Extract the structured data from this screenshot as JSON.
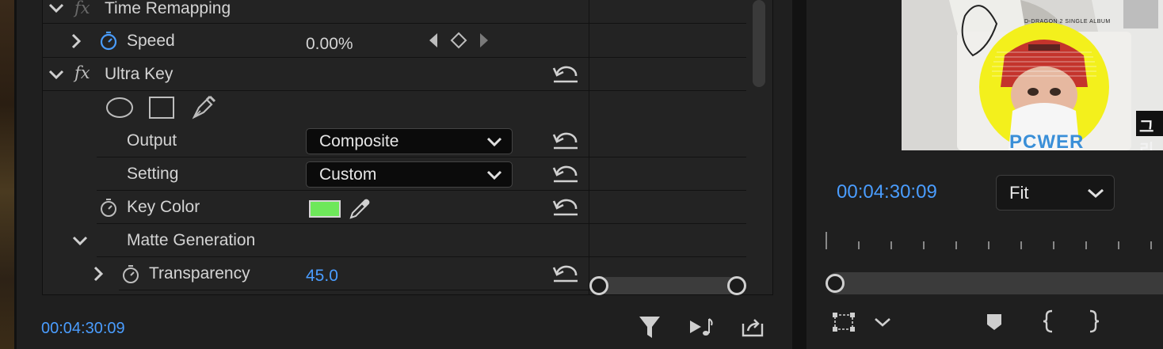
{
  "effect_controls": {
    "time_remapping": {
      "label": "Time Remapping"
    },
    "speed": {
      "label": "Speed",
      "value": "0.00%"
    },
    "ultra_key": {
      "label": "Ultra Key"
    },
    "output": {
      "label": "Output",
      "value": "Composite"
    },
    "setting": {
      "label": "Setting",
      "value": "Custom"
    },
    "key_color": {
      "label": "Key Color",
      "color": "#6ee85a"
    },
    "matte_generation": {
      "label": "Matte Generation"
    },
    "transparency": {
      "label": "Transparency",
      "value": "45.0"
    },
    "timecode": "00:04:30:09"
  },
  "program_monitor": {
    "timecode": "00:04:30:09",
    "zoom": {
      "value": "Fit"
    },
    "video": {
      "badge_text": "D-DRAGON 2 SINGLE ALBUM",
      "shirt_text": "PCWER",
      "subtitle_fragment": "그리"
    }
  },
  "colors": {
    "accent": "#4a9dff",
    "key_green": "#6ee85a",
    "video_circle": "#f3f01c"
  }
}
